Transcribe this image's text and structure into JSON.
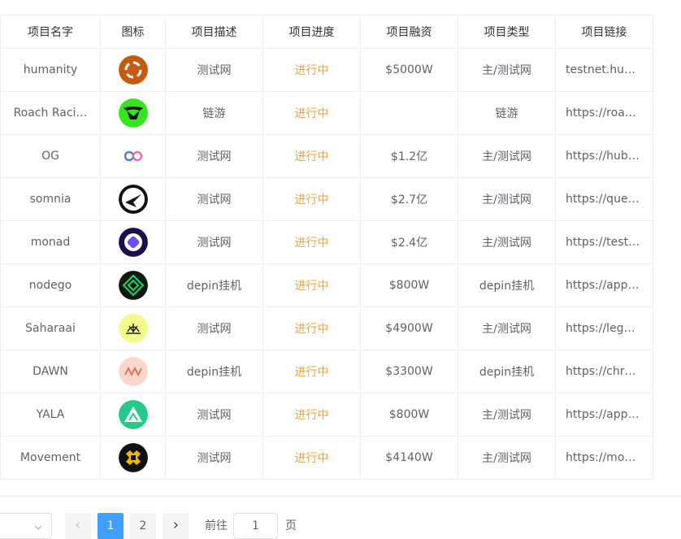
{
  "table": {
    "headers": [
      "项目名字",
      "图标",
      "项目描述",
      "项目进度",
      "项目融资",
      "项目类型",
      "项目链接"
    ],
    "rows": [
      {
        "name": "humanity",
        "icon": "humanity-logo-icon",
        "desc": "测试网",
        "progress": "进行中",
        "funding": "$5000W",
        "type": "主/测试网",
        "link": "testnet.hu…"
      },
      {
        "name": "Roach Raci…",
        "icon": "roach-racing-logo-icon",
        "desc": "链游",
        "progress": "进行中",
        "funding": "",
        "type": "链游",
        "link": "https://roa…"
      },
      {
        "name": "OG",
        "icon": "og-logo-icon",
        "desc": "测试网",
        "progress": "进行中",
        "funding": "$1.2亿",
        "type": "主/测试网",
        "link": "https://hub…"
      },
      {
        "name": "somnia",
        "icon": "somnia-logo-icon",
        "desc": "测试网",
        "progress": "进行中",
        "funding": "$2.7亿",
        "type": "主/测试网",
        "link": "https://que…"
      },
      {
        "name": "monad",
        "icon": "monad-logo-icon",
        "desc": "测试网",
        "progress": "进行中",
        "funding": "$2.4亿",
        "type": "主/测试网",
        "link": "https://test…"
      },
      {
        "name": "nodego",
        "icon": "nodego-logo-icon",
        "desc": "depin挂机",
        "progress": "进行中",
        "funding": "$800W",
        "type": "depin挂机",
        "link": "https://app…"
      },
      {
        "name": "Saharaai",
        "icon": "sahara-logo-icon",
        "desc": "测试网",
        "progress": "进行中",
        "funding": "$4900W",
        "type": "主/测试网",
        "link": "https://leg…"
      },
      {
        "name": "DAWN",
        "icon": "dawn-logo-icon",
        "desc": "depin挂机",
        "progress": "进行中",
        "funding": "$3300W",
        "type": "depin挂机",
        "link": "https://chr…"
      },
      {
        "name": "YALA",
        "icon": "yala-logo-icon",
        "desc": "测试网",
        "progress": "进行中",
        "funding": "$800W",
        "type": "主/测试网",
        "link": "https://app…"
      },
      {
        "name": "Movement",
        "icon": "movement-logo-icon",
        "desc": "测试网",
        "progress": "进行中",
        "funding": "$4140W",
        "type": "主/测试网",
        "link": "https://mo…"
      }
    ]
  },
  "pagination": {
    "prev_icon": "chevron-left-icon",
    "next_icon": "chevron-right-icon",
    "select_icon": "chevron-down-icon",
    "pages": [
      "1",
      "2"
    ],
    "active_page": "1",
    "goto_label": "前往",
    "goto_value": "1",
    "page_suffix": "页"
  },
  "colors": {
    "progress": "#f5a03a",
    "active_page": "#409eff",
    "border": "#ebeef5"
  }
}
